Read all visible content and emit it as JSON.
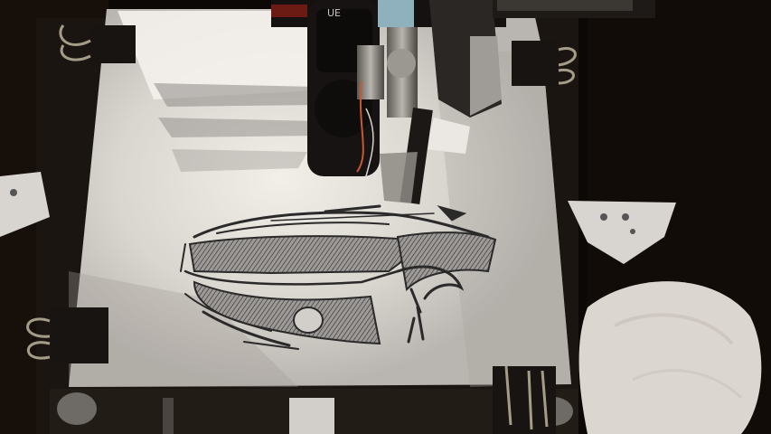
{
  "photo": {
    "subject": "pen-plotter-drawing-car",
    "colors": {
      "background": "#0c0805",
      "paper": "#dcd8d2",
      "paper_shadow": "#8e8a86",
      "ink": "#2b2a2a",
      "frame": "#1a1511",
      "clip": "#171412",
      "metal": "#8a8680",
      "bracket": "#d8d4cf",
      "fabric": "#e8e2dc"
    },
    "marking_on_carriage": "UE",
    "objects": [
      "drawing-board",
      "paper-sheet",
      "car-sketch",
      "plotter-carriage",
      "pen-holder",
      "binder-clips",
      "corner-brackets",
      "cloth"
    ]
  }
}
